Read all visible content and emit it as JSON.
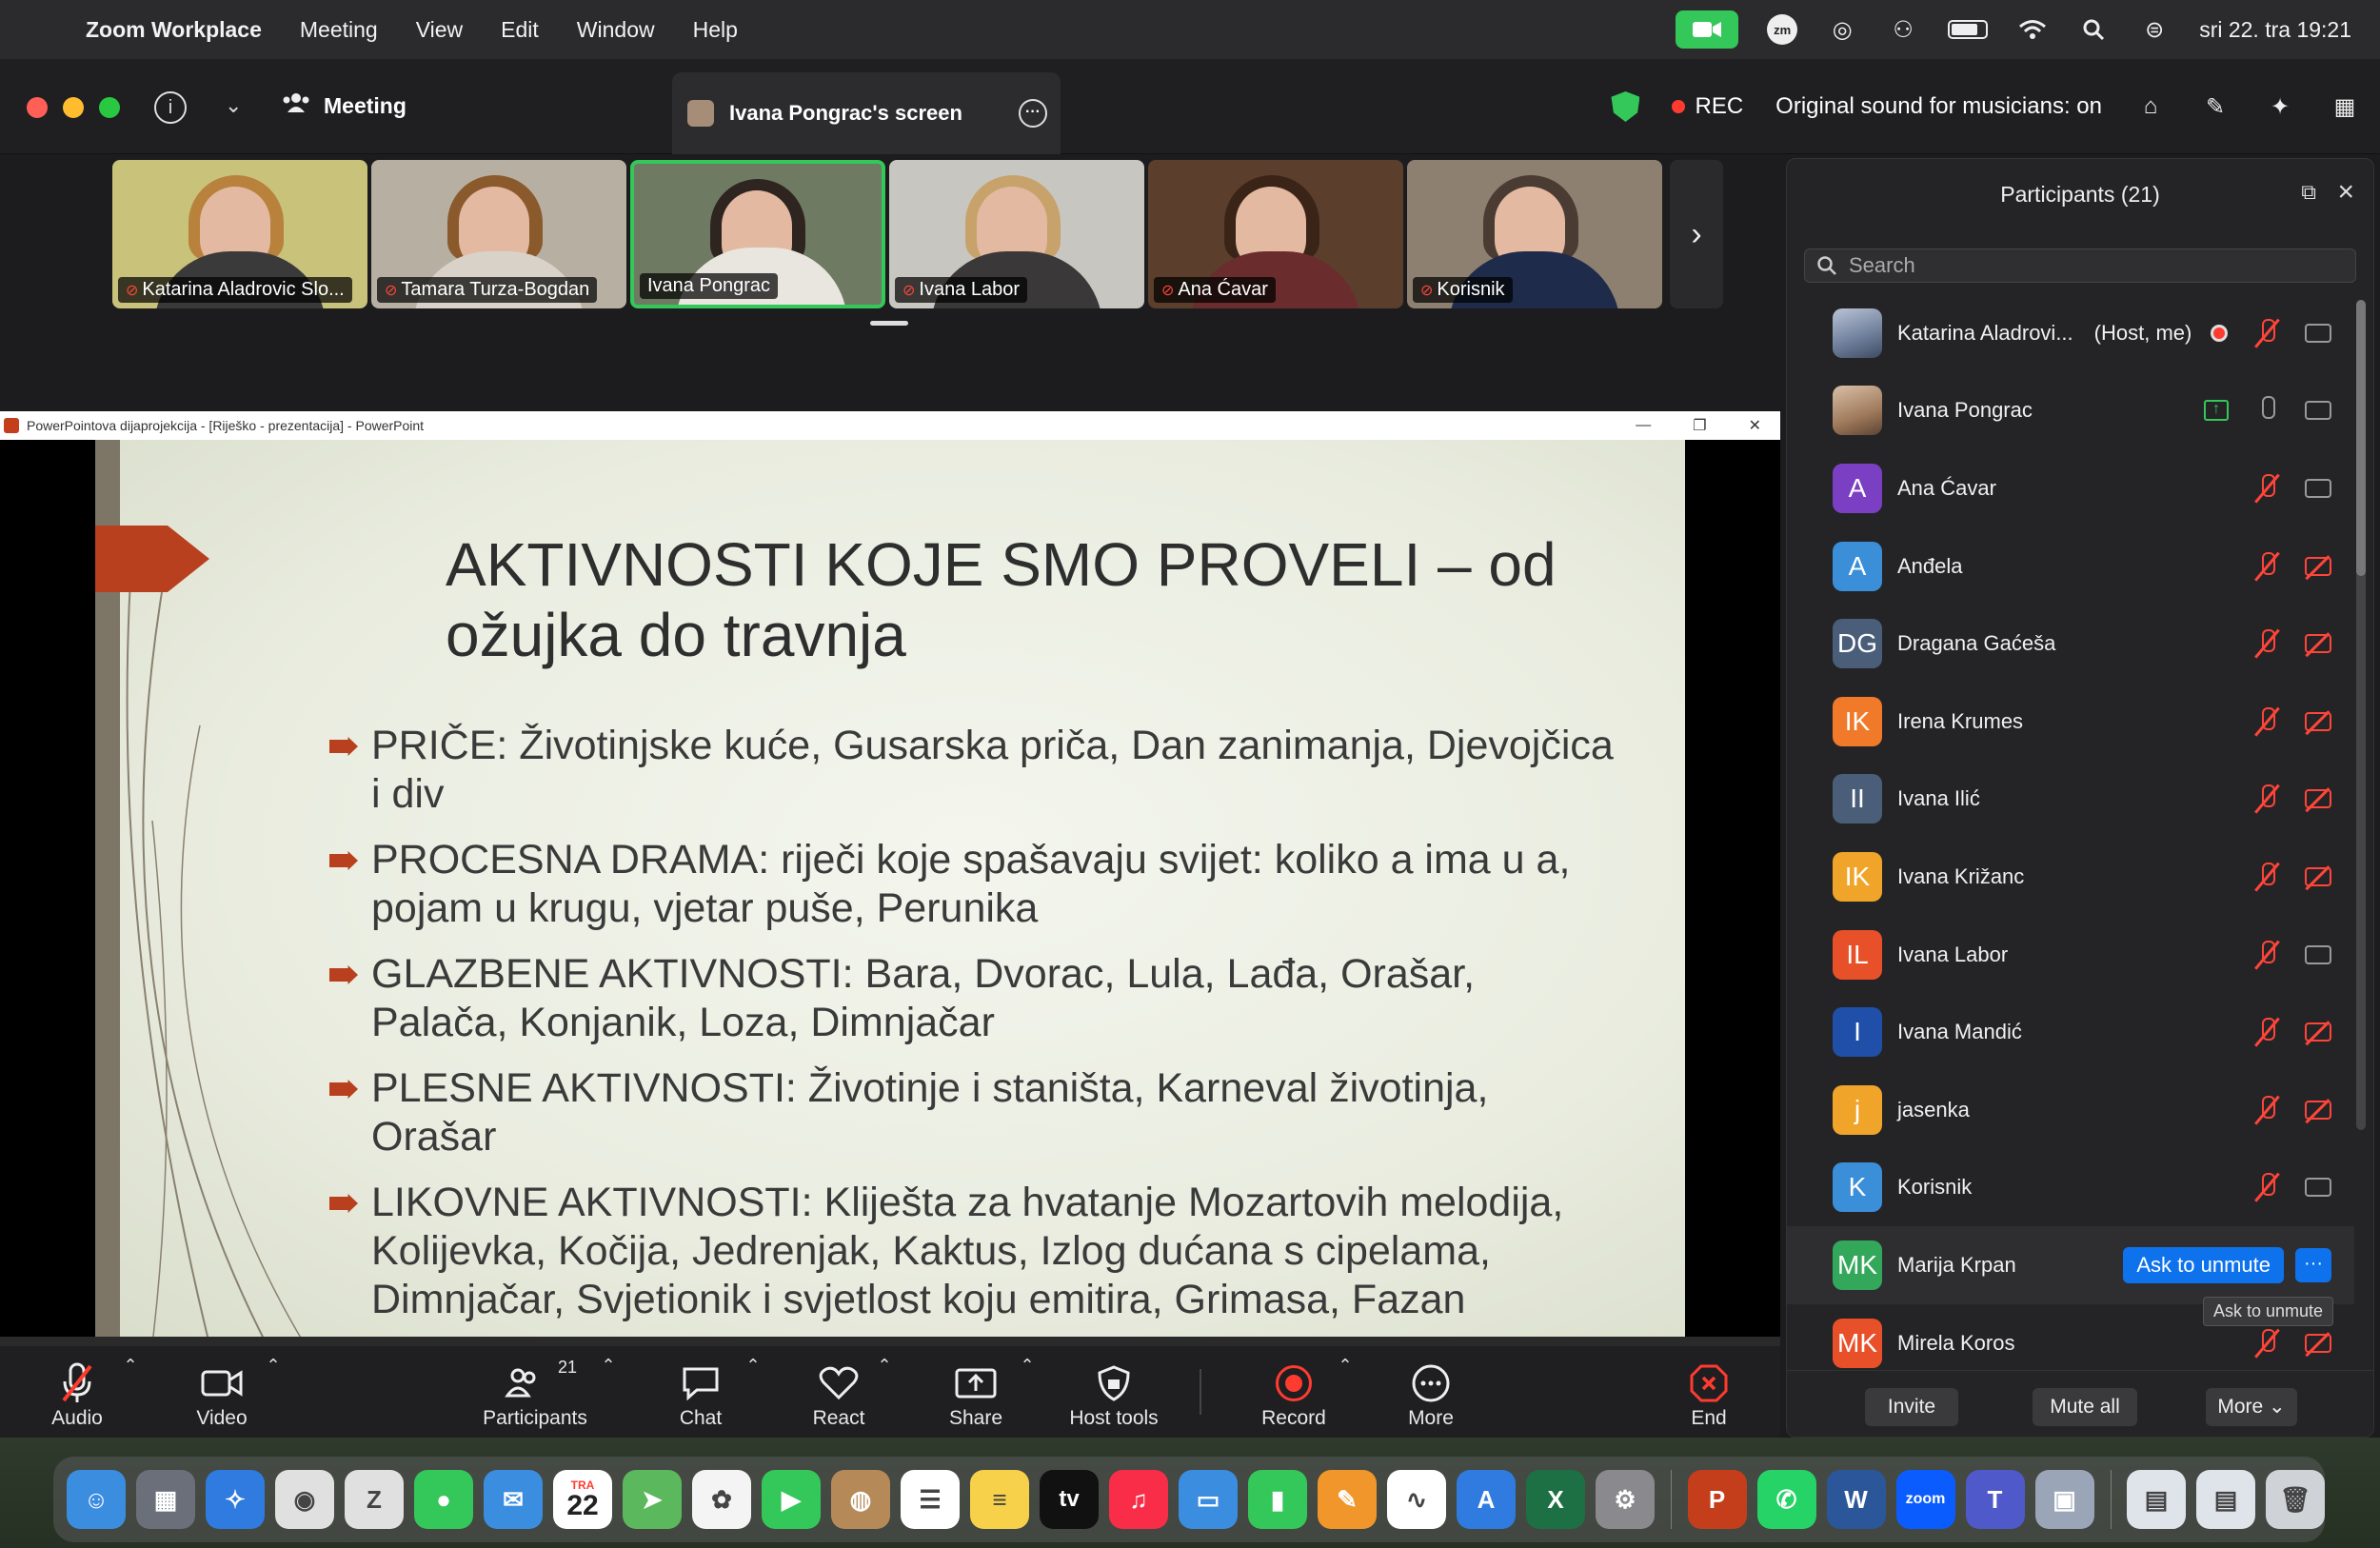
{
  "menubar": {
    "app_name": "Zoom Workplace",
    "menus": [
      "Meeting",
      "View",
      "Edit",
      "Window",
      "Help"
    ],
    "clock": "sri 22. tra  19:21",
    "zm_badge": "zm"
  },
  "toolbar": {
    "meeting_label": "Meeting",
    "screen_tab_label": "Ivana Pongrac's screen",
    "rec_label": "REC",
    "sound_label": "Original sound for musicians: on"
  },
  "video_tiles": [
    {
      "name": "Katarina Aladrovic Slo...",
      "muted": true,
      "bg": "#c9c27a",
      "hair": "#b8823d",
      "body": "#3a3a3a"
    },
    {
      "name": "Tamara Turza-Bogdan",
      "muted": true,
      "bg": "#b7b0a2",
      "hair": "#8a5a2c",
      "body": "#d8d2c8"
    },
    {
      "name": "Ivana Pongrac",
      "muted": false,
      "bg": "#6f7a63",
      "hair": "#2e2520",
      "body": "#e9e6e0"
    },
    {
      "name": "Ivana Labor",
      "muted": true,
      "bg": "#c8c6c1",
      "hair": "#c7a36b",
      "body": "#3a3838"
    },
    {
      "name": "Ana Ćavar",
      "muted": true,
      "bg": "#5b3f2c",
      "hair": "#3a2418",
      "body": "#6a2c2c"
    },
    {
      "name": "Korisnik",
      "muted": true,
      "bg": "#8e8070",
      "hair": "#4a3c33",
      "body": "#1e2b4a"
    }
  ],
  "shared_screen": {
    "window_title": "PowerPointova dijaprojekcija - [Riješko - prezentacija] - PowerPoint",
    "slide_title": "AKTIVNOSTI KOJE SMO PROVELI – od ožujka do travnja",
    "bullets": [
      "PRIČE: Životinjske kuće, Gusarska priča, Dan zanimanja, Djevojčica i div",
      "PROCESNA DRAMA: riječi koje spašavaju svijet: koliko a ima u a, pojam u krugu, vjetar puše, Perunika",
      "GLAZBENE AKTIVNOSTI: Bara, Dvorac, Lula, Lađa, Orašar, Palača, Konjanik, Loza, Dimnjačar",
      "PLESNE AKTIVNOSTI: Životinje i staništa, Karneval životinja, Orašar",
      "LIKOVNE AKTIVNOSTI: Kliješta za hvatanje Mozartovih melodija, Kolijevka, Kočija, Jedrenjak, Kaktus, Izlog dućana s cipelama, Dimnjačar, Svjetionik i svjetlost koju emitira, Grimasa, Fazan"
    ]
  },
  "controls": {
    "audio": "Audio",
    "video": "Video",
    "participants": "Participants",
    "participants_count": "21",
    "chat": "Chat",
    "react": "React",
    "share": "Share",
    "host_tools": "Host tools",
    "record": "Record",
    "more": "More",
    "end": "End"
  },
  "participants_panel": {
    "title": "Participants (21)",
    "search_placeholder": "Search",
    "people": [
      {
        "initials": "",
        "name": "Katarina Aladrovi...",
        "tag": "(Host, me)",
        "color": "photo",
        "mic": "off",
        "cam": "on",
        "recording": true
      },
      {
        "initials": "",
        "name": "Ivana Pongrac",
        "tag": "",
        "color": "photo2",
        "mic": "on",
        "cam": "on",
        "sharing": true
      },
      {
        "initials": "A",
        "name": "Ana Ćavar",
        "color": "#7b3fc4",
        "mic": "off",
        "cam": "on"
      },
      {
        "initials": "A",
        "name": "Anđela",
        "color": "#3a8fd8",
        "mic": "off",
        "cam": "off"
      },
      {
        "initials": "DG",
        "name": "Dragana Gaćeša",
        "color": "#4a5e7a",
        "mic": "off",
        "cam": "off"
      },
      {
        "initials": "IK",
        "name": "Irena Krumes",
        "color": "#f07a2a",
        "mic": "off",
        "cam": "off"
      },
      {
        "initials": "II",
        "name": "Ivana Ilić",
        "color": "#4a5e7a",
        "mic": "off",
        "cam": "off"
      },
      {
        "initials": "IK",
        "name": "Ivana Križanc",
        "color": "#f0a52a",
        "mic": "off",
        "cam": "off"
      },
      {
        "initials": "IL",
        "name": "Ivana Labor",
        "color": "#e8502a",
        "mic": "off",
        "cam": "on"
      },
      {
        "initials": "I",
        "name": "Ivana Mandić",
        "color": "#1f4fa8",
        "mic": "off",
        "cam": "off"
      },
      {
        "initials": "j",
        "name": "jasenka",
        "color": "#f0a52a",
        "mic": "off",
        "cam": "off"
      },
      {
        "initials": "K",
        "name": "Korisnik",
        "color": "#3a8fd8",
        "mic": "off",
        "cam": "on"
      },
      {
        "initials": "MK",
        "name": "Marija Krpan",
        "color": "#34a85a",
        "hover": true
      },
      {
        "initials": "MK",
        "name": "Mirela Koros",
        "color": "#e8502a",
        "mic": "off",
        "cam": "off"
      }
    ],
    "ask_to_unmute": "Ask to unmute",
    "tooltip": "Ask to unmute",
    "invite": "Invite",
    "mute_all": "Mute all",
    "more": "More"
  },
  "dock": {
    "calendar_month": "TRA",
    "calendar_day": "22",
    "tv_label": "tv",
    "zoom_label": "zoom",
    "apps": [
      {
        "name": "finder",
        "color": "#3b8de0",
        "glyph": "☺"
      },
      {
        "name": "launchpad",
        "color": "#6a6f7a",
        "glyph": "▦"
      },
      {
        "name": "safari",
        "color": "#2f7be0",
        "glyph": "✧"
      },
      {
        "name": "chrome",
        "color": "#e0e0e0",
        "glyph": "◉"
      },
      {
        "name": "zotero",
        "color": "#e0e0e0",
        "glyph": "Z"
      },
      {
        "name": "messages",
        "color": "#34c759",
        "glyph": "●"
      },
      {
        "name": "mail",
        "color": "#3b8de0",
        "glyph": "✉"
      },
      {
        "name": "calendar",
        "color": "#ffffff",
        "glyph": ""
      },
      {
        "name": "maps",
        "color": "#5cb85c",
        "glyph": "➤"
      },
      {
        "name": "photos",
        "color": "#f4f4f4",
        "glyph": "✿"
      },
      {
        "name": "facetime",
        "color": "#34c759",
        "glyph": "▶"
      },
      {
        "name": "contacts",
        "color": "#b58a58",
        "glyph": "◍"
      },
      {
        "name": "reminders",
        "color": "#ffffff",
        "glyph": "☰"
      },
      {
        "name": "notes",
        "color": "#f7d14a",
        "glyph": "≡"
      },
      {
        "name": "apple-tv",
        "color": "#111111",
        "glyph": ""
      },
      {
        "name": "music",
        "color": "#fa2d48",
        "glyph": "♫"
      },
      {
        "name": "keynote",
        "color": "#3b8de0",
        "glyph": "▭"
      },
      {
        "name": "numbers",
        "color": "#34c759",
        "glyph": "▮"
      },
      {
        "name": "pages",
        "color": "#f0962a",
        "glyph": "✎"
      },
      {
        "name": "freeform",
        "color": "#ffffff",
        "glyph": "∿"
      },
      {
        "name": "app-store",
        "color": "#2f7be0",
        "glyph": "A"
      },
      {
        "name": "excel",
        "color": "#1d7044",
        "glyph": "X"
      },
      {
        "name": "system-settings",
        "color": "#8a8a8e",
        "glyph": "⚙"
      },
      {
        "name": "sep",
        "color": "",
        "glyph": ""
      },
      {
        "name": "powerpoint",
        "color": "#c43e1c",
        "glyph": "P"
      },
      {
        "name": "whatsapp",
        "color": "#25d366",
        "glyph": "✆"
      },
      {
        "name": "word",
        "color": "#2b579a",
        "glyph": "W"
      },
      {
        "name": "zoom",
        "color": "#0b5cff",
        "glyph": ""
      },
      {
        "name": "teams",
        "color": "#5059c9",
        "glyph": "T"
      },
      {
        "name": "preview",
        "color": "#9aa6b8",
        "glyph": "▣"
      },
      {
        "name": "sep",
        "color": "",
        "glyph": ""
      },
      {
        "name": "documents",
        "color": "#dfe3ea",
        "glyph": "▤"
      },
      {
        "name": "documents-2",
        "color": "#dfe3ea",
        "glyph": "▤"
      },
      {
        "name": "trash",
        "color": "#cfd3d8",
        "glyph": "🗑"
      }
    ]
  }
}
